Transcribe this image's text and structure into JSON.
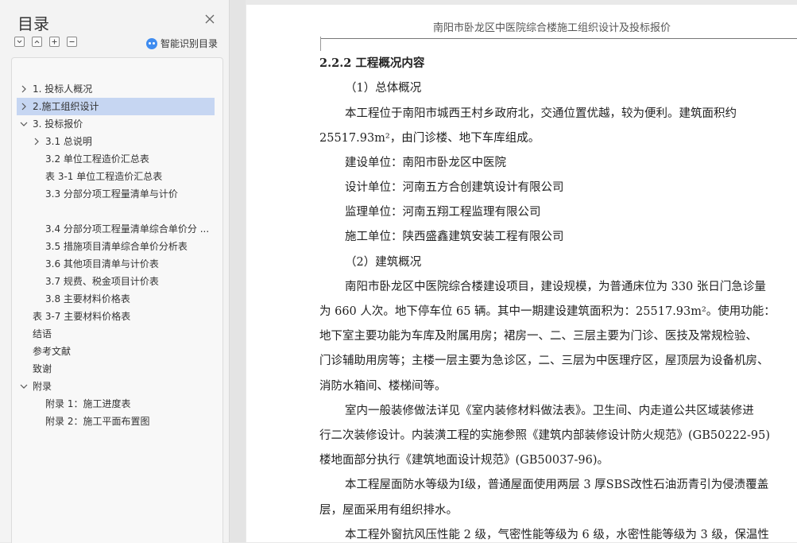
{
  "sidebar": {
    "title": "目录",
    "smart_label": "智能识别目录",
    "toc": [
      {
        "label": "1. 投标人概况",
        "arrow": "right"
      },
      {
        "label": "2.施工组织设计",
        "arrow": "right"
      },
      {
        "label": "3. 投标报价",
        "arrow": "down"
      },
      {
        "label": "3.1 总说明",
        "arrow": "right"
      },
      {
        "label": "3.2 单位工程造价汇总表",
        "arrow": ""
      },
      {
        "label": "表 3-1 单位工程造价汇总表",
        "arrow": ""
      },
      {
        "label": "3.3 分部分项工程量清单与计价",
        "arrow": ""
      },
      {
        "label": "3.4 分部分项工程量清单综合单价分 ...",
        "arrow": ""
      },
      {
        "label": "3.5 措施项目清单综合单价分析表",
        "arrow": ""
      },
      {
        "label": "3.6 其他项目清单与计价表",
        "arrow": ""
      },
      {
        "label": "3.7 规费、税金项目计价表",
        "arrow": ""
      },
      {
        "label": "3.8 主要材料价格表",
        "arrow": ""
      },
      {
        "label": "表 3-7 主要材料价格表",
        "arrow": ""
      },
      {
        "label": "结语",
        "arrow": ""
      },
      {
        "label": "参考文献",
        "arrow": ""
      },
      {
        "label": "致谢",
        "arrow": ""
      },
      {
        "label": "附录",
        "arrow": "down"
      },
      {
        "label": "附录 1：施工进度表",
        "arrow": ""
      },
      {
        "label": "附录 2：施工平面布置图",
        "arrow": ""
      }
    ]
  },
  "document": {
    "header": "南阳市卧龙区中医院综合楼施工组织设计及投标报价",
    "lines": [
      "2.2.2 工程概况内容",
      "（1）总体概况",
      "本工程位于南阳市城西王村乡政府北，交通位置优越，较为便利。建筑面积约",
      "25517.93m²，由门诊楼、地下车库组成。",
      "建设单位：南阳市卧龙区中医院",
      "设计单位：河南五方合创建筑设计有限公司",
      "监理单位：河南五翔工程监理有限公司",
      "施工单位：陕西盛鑫建筑安装工程有限公司",
      "（2）建筑概况",
      "南阳市卧龙区中医院综合楼建设项目，建设规模，为普通床位为 330 张日门急诊量",
      "为 660 人次。地下停车位 65 辆。其中一期建设建筑面积为：25517.93m²。使用功能：",
      "地下室主要功能为车库及附属用房；裙房一、二、三层主要为门诊、医技及常规检验、",
      "门诊辅助用房等；主楼一层主要为急诊区，二、三层为中医理疗区，屋顶层为设备机房、",
      "消防水箱间、楼梯间等。",
      "室内一般装修做法详见《室内装修材料做法表》。卫生间、内走道公共区域装修进",
      "行二次装修设计。内装潢工程的实施参照《建筑内部装修设计防火规范》(GB50222-95)",
      "楼地面部分执行《建筑地面设计规范》(GB50037-96)。",
      "本工程屋面防水等级为Ⅰ级，普通屋面使用两层 3 厚SBS改性石油沥青引为侵渍覆盖",
      "层，屋面采用有组织排水。",
      "本工程外窗抗风压性能 2 级，气密性能等级为 6 级，水密性能等级为 3 级，保温性"
    ]
  }
}
